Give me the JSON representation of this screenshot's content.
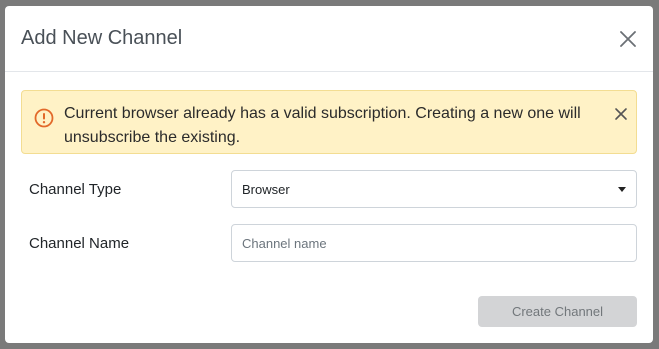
{
  "modal": {
    "title": "Add New Channel"
  },
  "alert": {
    "message": "Current browser already has a valid subscription. Creating a new one will unsubscribe the existing.",
    "color": "#fff2c6",
    "icon": "exclamation-circle-icon"
  },
  "form": {
    "channel_type": {
      "label": "Channel Type",
      "selected": "Browser"
    },
    "channel_name": {
      "label": "Channel Name",
      "placeholder": "Channel name",
      "value": ""
    }
  },
  "footer": {
    "create_label": "Create Channel",
    "disabled": true
  }
}
